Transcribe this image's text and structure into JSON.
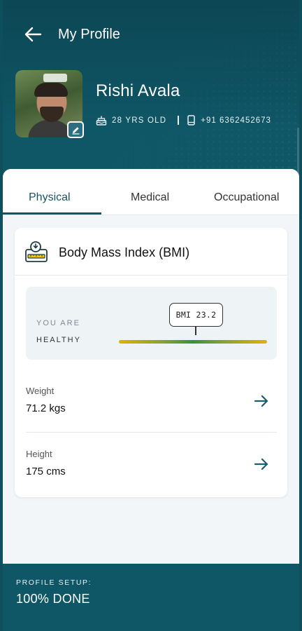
{
  "header": {
    "title": "My Profile",
    "back_icon": "arrow-left-icon"
  },
  "profile": {
    "name": "Rishi Avala",
    "age": "28 YRS OLD",
    "phone": "+91 6362452673",
    "age_icon": "cake-icon",
    "phone_icon": "phone-icon",
    "edit_icon": "pencil-icon"
  },
  "tabs": [
    {
      "label": "Physical",
      "active": true
    },
    {
      "label": "Medical",
      "active": false
    },
    {
      "label": "Occupational",
      "active": false
    }
  ],
  "bmi_card": {
    "title": "Body Mass Index (BMI)",
    "icon": "bmi-scale-icon",
    "status_prefix": "YOU ARE",
    "status": "HEALTHY",
    "bmi_label": "BMI 23.2",
    "rows": [
      {
        "label": "Weight",
        "value": "71.2 kgs"
      },
      {
        "label": "Height",
        "value": "175 cms"
      }
    ],
    "row_icon": "arrow-right-icon"
  },
  "footer": {
    "label": "PROFILE SETUP:",
    "value": "100% DONE"
  },
  "colors": {
    "primary": "#0f5666",
    "accent": "#17535f",
    "healthy_green": "#3f8e3a",
    "warning_yellow": "#d8b312"
  }
}
